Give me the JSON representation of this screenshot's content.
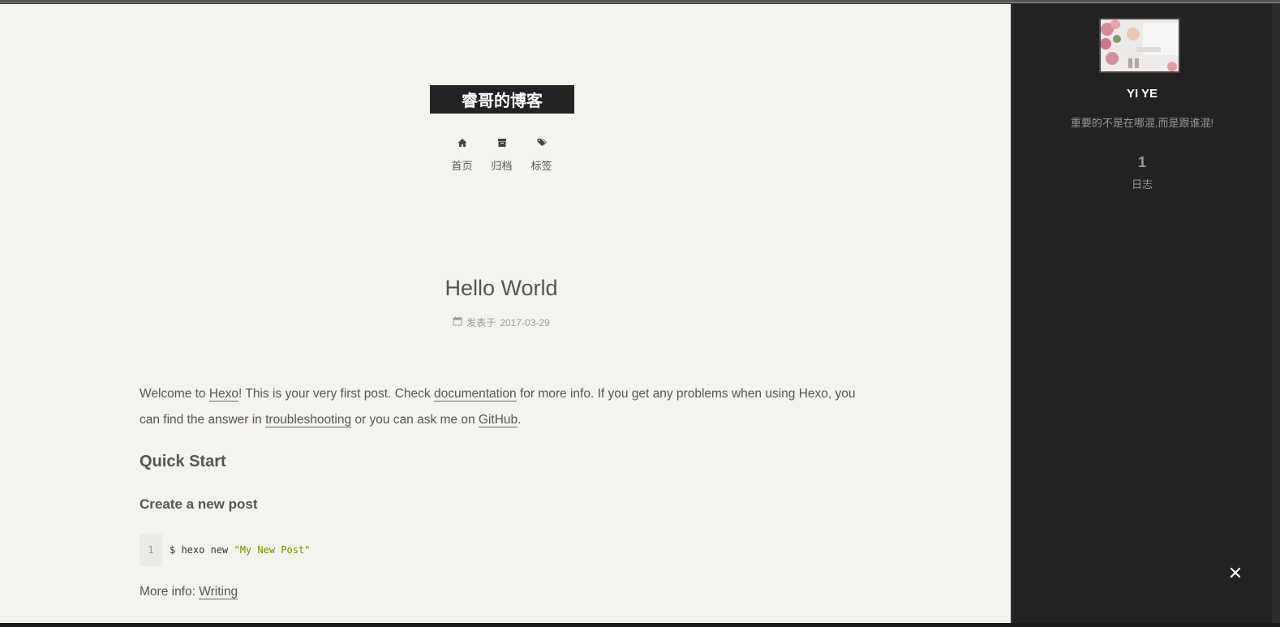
{
  "site": {
    "title": "睿哥的博客"
  },
  "nav": [
    {
      "label": "首页",
      "icon": "home-icon"
    },
    {
      "label": "归档",
      "icon": "archive-icon"
    },
    {
      "label": "标签",
      "icon": "tags-icon"
    }
  ],
  "post": {
    "title": "Hello World",
    "meta_label": "发表于",
    "date": "2017-03-29",
    "p1_a": "Welcome to ",
    "p1_link1": "Hexo",
    "p1_b": "! This is your very first post. Check ",
    "p1_link2": "documentation",
    "p1_c": " for more info. If you get any problems when using Hexo, you can find the answer in ",
    "p1_link3": "troubleshooting",
    "p1_d": " or you can ask me on ",
    "p1_link4": "GitHub",
    "p1_e": ".",
    "h2": "Quick Start",
    "h3": "Create a new post",
    "code_line_no": "1",
    "code_cmd": "$ hexo new ",
    "code_str": "\"My New Post\"",
    "more_label": "More info: ",
    "more_link": "Writing"
  },
  "sidebar": {
    "author": "YI YE",
    "motto": "重要的不是在哪混,而是跟谁混!",
    "posts_count": "1",
    "posts_label": "日志"
  },
  "colors": {
    "sidebar_bg": "#222222",
    "main_bg": "#f5f3ed",
    "title_box": "#222222"
  }
}
